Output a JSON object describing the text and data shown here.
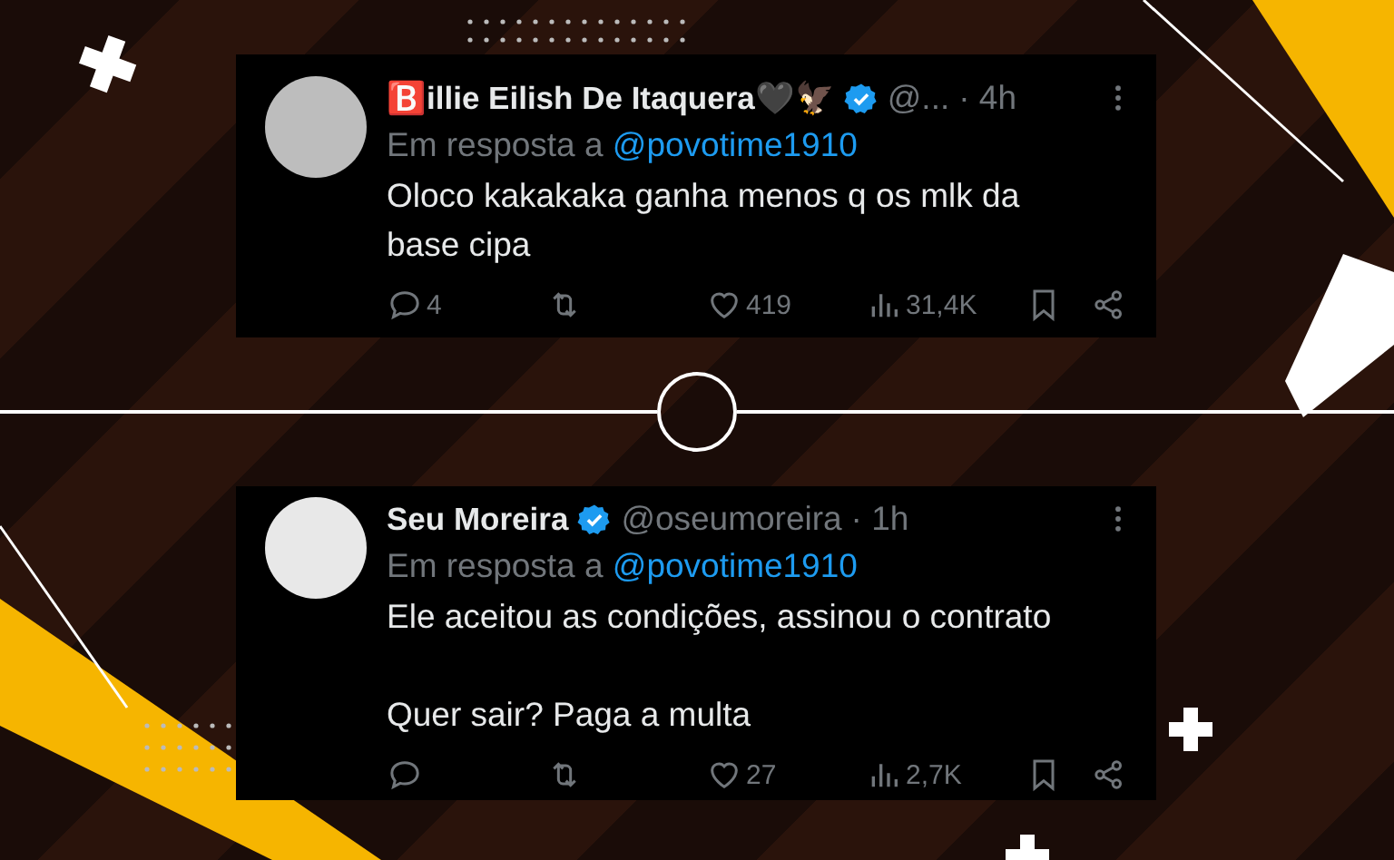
{
  "tweets": [
    {
      "name": "🅱️illie Eilish De Itaquera🖤🦅",
      "verified": true,
      "handle": "@...",
      "time": "· 4h",
      "reply_label": "Em resposta a",
      "reply_to": "@povotime1910",
      "text": [
        "Oloco kakakaka ganha menos q os mlk da base cipa"
      ],
      "replies": "4",
      "likes": "419",
      "views": "31,4K"
    },
    {
      "name": "Seu Moreira",
      "verified": true,
      "handle": "@oseumoreira",
      "time": "· 1h",
      "reply_label": "Em resposta a",
      "reply_to": "@povotime1910",
      "text": [
        "Ele aceitou as condições, assinou o contrato",
        "Quer sair? Paga a multa"
      ],
      "likes": "27",
      "views": "2,7K"
    }
  ]
}
